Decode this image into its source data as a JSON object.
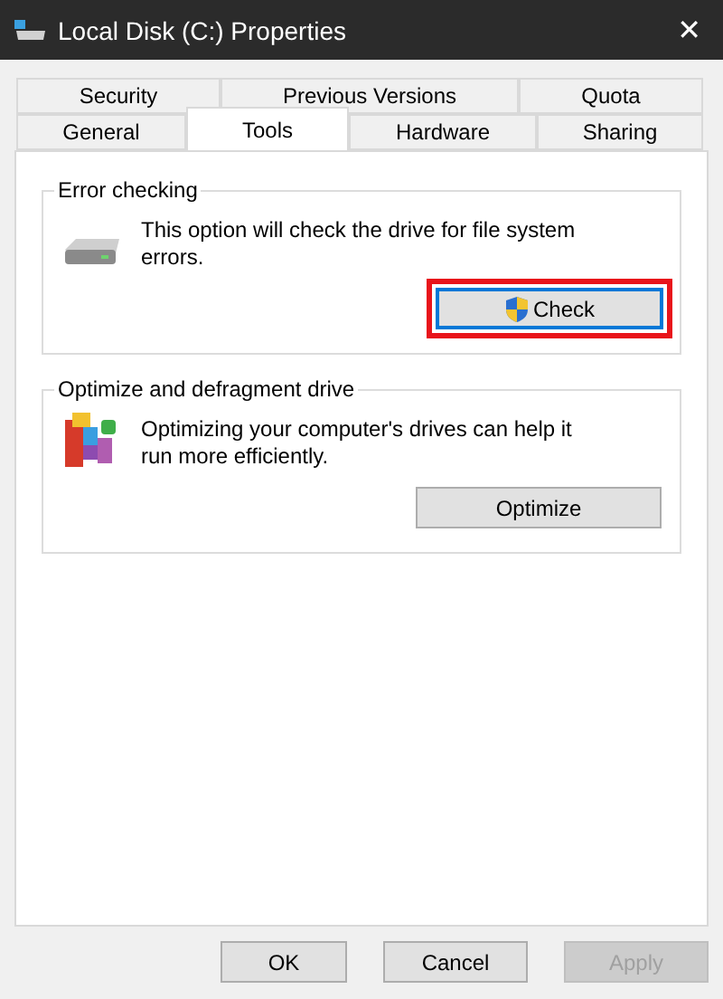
{
  "window": {
    "title": "Local Disk (C:) Properties",
    "close": "✕"
  },
  "tab_rows": [
    [
      {
        "label": "Security",
        "selected": false
      },
      {
        "label": "Previous Versions",
        "selected": false
      },
      {
        "label": "Quota",
        "selected": false
      }
    ],
    [
      {
        "label": "General",
        "selected": false
      },
      {
        "label": "Tools",
        "selected": true
      },
      {
        "label": "Hardware",
        "selected": false
      },
      {
        "label": "Sharing",
        "selected": false
      }
    ]
  ],
  "groups": [
    {
      "kind": "error",
      "title": "Error checking",
      "text": "This option will check the drive for file system errors.",
      "button": {
        "label": "Check",
        "shield": true,
        "focused": true,
        "highlighted": true
      }
    },
    {
      "kind": "defrag",
      "title": "Optimize and defragment drive",
      "text": "Optimizing your computer's drives can help it run more efficiently.",
      "button": {
        "label": "Optimize",
        "shield": false,
        "focused": false,
        "highlighted": false
      }
    }
  ],
  "buttons": [
    {
      "label": "OK",
      "disabled": false
    },
    {
      "label": "Cancel",
      "disabled": false
    },
    {
      "label": "Apply",
      "disabled": true
    }
  ]
}
